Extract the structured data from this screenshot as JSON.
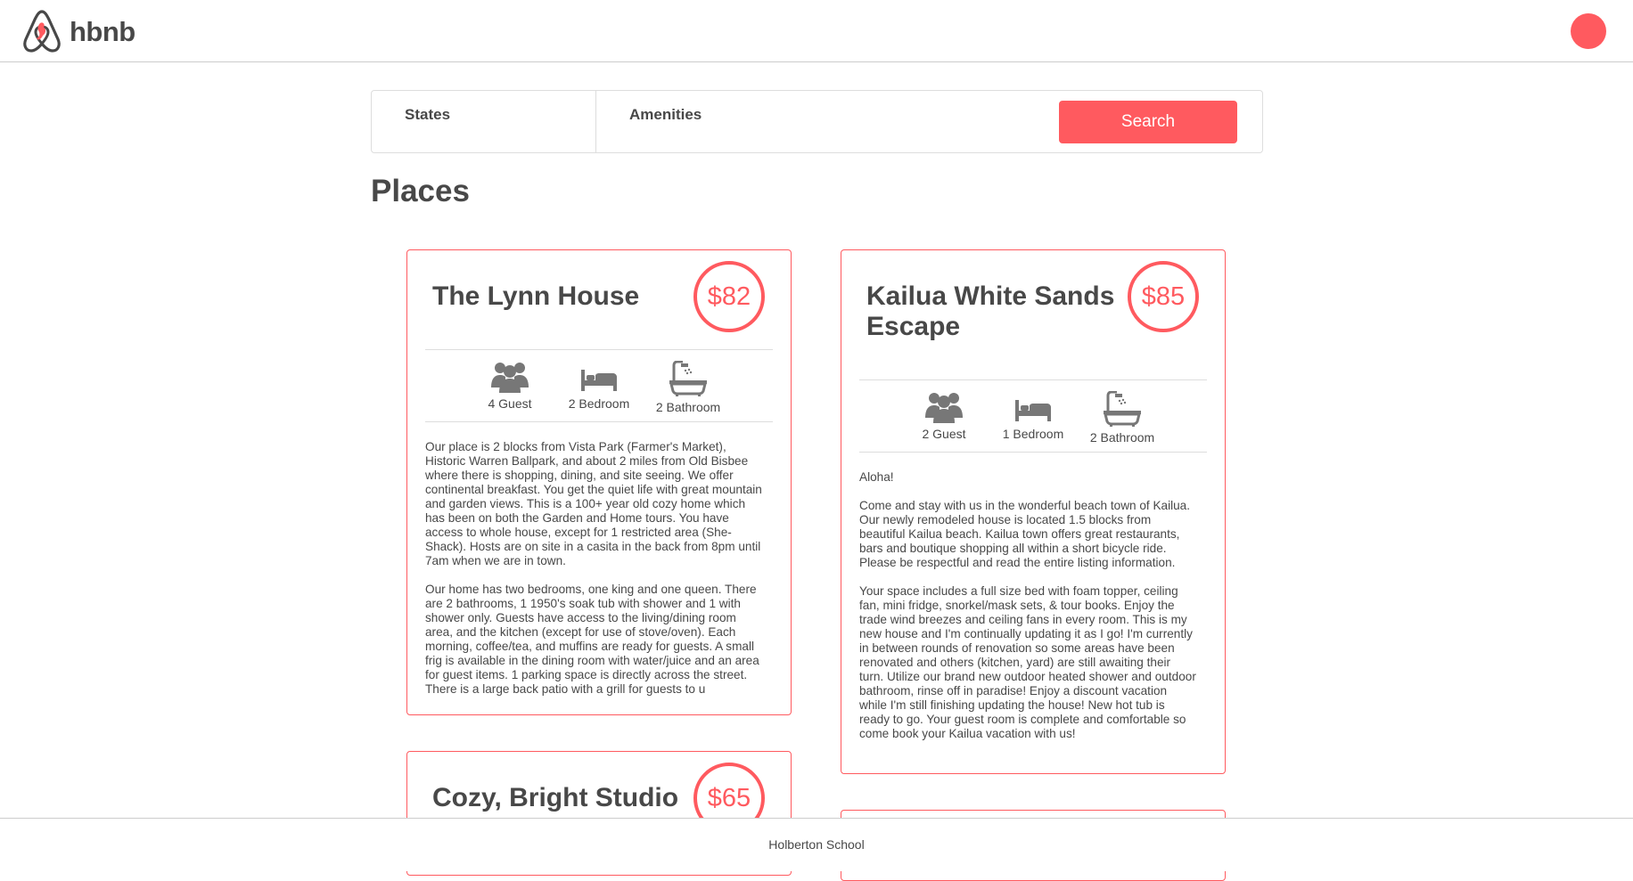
{
  "brand": {
    "name": "hbnb",
    "accent": "#ff5a5f"
  },
  "filters": {
    "states_title": "States",
    "amenities_title": "Amenities",
    "search_label": "Search"
  },
  "places_title": "Places",
  "places": [
    {
      "name": "The Lynn House",
      "price": "$82",
      "guests": "4 Guest",
      "bedrooms": "2 Bedroom",
      "bathrooms": "2 Bathroom",
      "description": "Our place is 2 blocks from Vista Park (Farmer's Market),\nHistoric Warren Ballpark, and about 2 miles from Old Bisbee\nwhere there is shopping, dining, and site seeing. We offer\ncontinental breakfast. You get the quiet life with great mountain\nand garden views. This is a 100+ year old cozy home which\nhas been on both the Garden and Home tours. You have\naccess to whole house, except for 1 restricted area (She-\nShack). Hosts are on site in a casita in the back from 8pm until\n7am when we are in town.\n\nOur home has two bedrooms, one king and one queen. There\nare 2 bathrooms, 1 1950's soak tub with shower and 1 with\nshower only. Guests have access to the living/dining room\narea, and the kitchen (except for use of stove/oven). Each\nmorning, coffee/tea, and muffins are ready for guests. A small\nfrig is available in the dining room with water/juice and an area\nfor guest items. 1 parking space is directly across the street.\nThere is a large back patio with a grill for guests to u"
    },
    {
      "name": "Kailua White Sands Escape",
      "price": "$85",
      "guests": "2 Guest",
      "bedrooms": "1 Bedroom",
      "bathrooms": "2 Bathroom",
      "description": "Aloha!\n\nCome and stay with us in the wonderful beach town of Kailua.\nOur newly remodeled house is located 1.5 blocks from\nbeautiful Kailua beach. Kailua town offers great restaurants,\nbars and boutique shopping all within a short bicycle ride.\nPlease be respectful and read the entire listing information.\n\nYour space includes a full size bed with foam topper, ceiling\nfan, mini fridge, snorkel/mask sets, & tour books. Enjoy the\ntrade wind breezes and ceiling fans in every room. This is my\nnew house and I'm continually updating it as I go! I'm currently\nin between rounds of renovation so some areas have been\nrenovated and others (kitchen, yard) are still awaiting their\nturn. Utilize our brand new outdoor heated shower and outdoor\nbathroom, rinse off in paradise! Enjoy a discount vacation\nwhile I'm still finishing updating the house! New hot tub is\nready to go. Your guest room is complete and comfortable so\ncome book your Kailua vacation with us!"
    },
    {
      "name": "Cozy, Bright Studio",
      "price": "$65"
    }
  ],
  "footer": {
    "text": "Holberton School"
  }
}
